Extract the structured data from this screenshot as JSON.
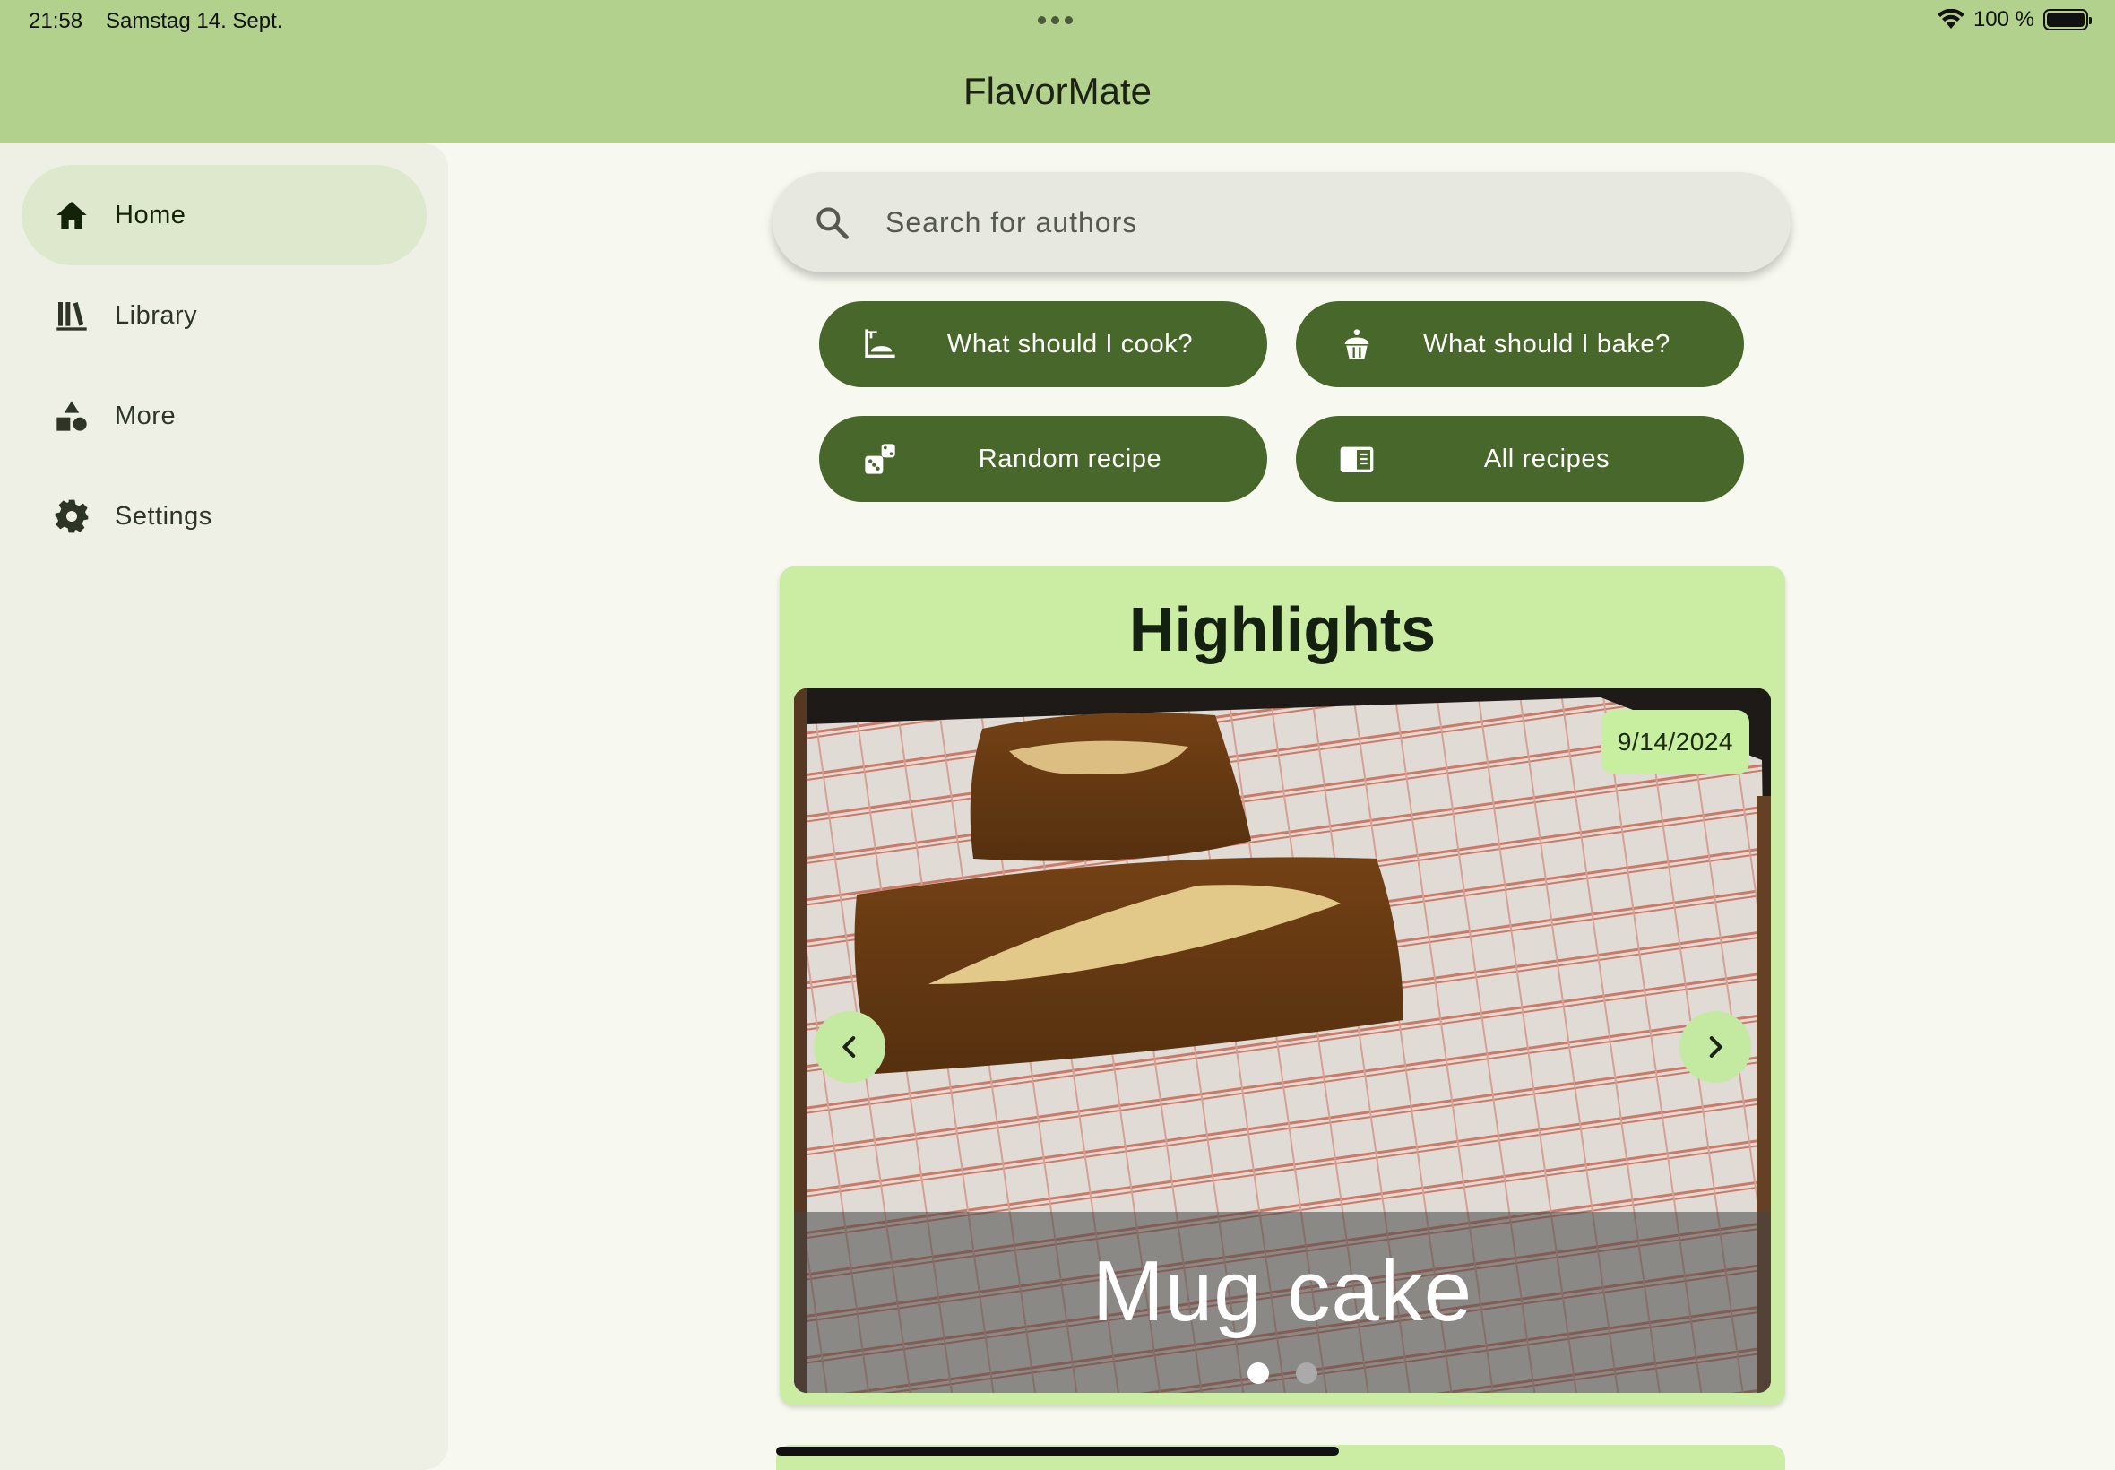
{
  "status": {
    "time": "21:58",
    "date": "Samstag 14. Sept.",
    "battery": "100 %",
    "battery_level": 1.0
  },
  "app": {
    "title": "FlavorMate"
  },
  "nav": {
    "items": [
      {
        "label": "Home",
        "icon": "home-icon",
        "active": true
      },
      {
        "label": "Library",
        "icon": "library-icon",
        "active": false
      },
      {
        "label": "More",
        "icon": "shapes-icon",
        "active": false
      },
      {
        "label": "Settings",
        "icon": "gear-icon",
        "active": false
      }
    ]
  },
  "search": {
    "placeholder": "Search for authors",
    "value": ""
  },
  "actions": [
    {
      "label": "What should I cook?",
      "icon": "cooking-pot-icon"
    },
    {
      "label": "What should I bake?",
      "icon": "cupcake-icon"
    },
    {
      "label": "Random recipe",
      "icon": "dice-icon"
    },
    {
      "label": "All recipes",
      "icon": "menu-book-icon"
    }
  ],
  "highlights": {
    "title": "Highlights",
    "date": "9/14/2024",
    "recipe_name": "Mug cake",
    "page_count": 2,
    "current_page": 1
  },
  "colors": {
    "app_bar": "#b2d18c",
    "drawer": "#eef0e6",
    "nav_active": "#dde8cc",
    "button": "#48672a",
    "card": "#cbeca3",
    "background": "#f7f9f0"
  }
}
